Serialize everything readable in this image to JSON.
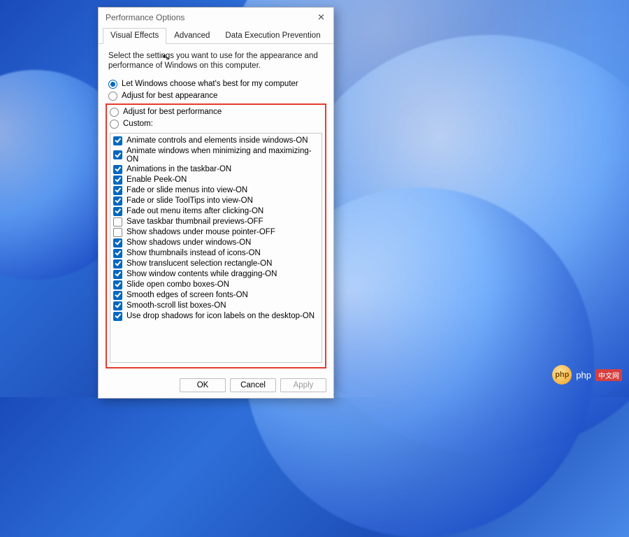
{
  "dialog": {
    "title": "Performance Options",
    "tabs": [
      {
        "label": "Visual Effects",
        "active": true
      },
      {
        "label": "Advanced",
        "active": false
      },
      {
        "label": "Data Execution Prevention",
        "active": false
      }
    ],
    "description": "Select the settings you want to use for the appearance and performance of Windows on this computer.",
    "radios": [
      {
        "label": "Let Windows choose what's best for my computer",
        "selected": true,
        "in_highlight": false
      },
      {
        "label": "Adjust for best appearance",
        "selected": false,
        "in_highlight": false
      },
      {
        "label": "Adjust for best performance",
        "selected": false,
        "in_highlight": true
      },
      {
        "label": "Custom:",
        "selected": false,
        "in_highlight": true
      }
    ],
    "checkboxes": [
      {
        "label": "Animate controls and elements inside windows-ON",
        "checked": true
      },
      {
        "label": "Animate windows when minimizing and maximizing-ON",
        "checked": true
      },
      {
        "label": "Animations in the taskbar-ON",
        "checked": true
      },
      {
        "label": "Enable Peek-ON",
        "checked": true
      },
      {
        "label": "Fade or slide menus into view-ON",
        "checked": true
      },
      {
        "label": "Fade or slide ToolTips into view-ON",
        "checked": true
      },
      {
        "label": "Fade out menu items after clicking-ON",
        "checked": true
      },
      {
        "label": "Save taskbar thumbnail previews-OFF",
        "checked": false
      },
      {
        "label": "Show shadows under mouse pointer-OFF",
        "checked": false
      },
      {
        "label": "Show shadows under windows-ON",
        "checked": true
      },
      {
        "label": "Show thumbnails instead of icons-ON",
        "checked": true
      },
      {
        "label": "Show translucent selection rectangle-ON",
        "checked": true
      },
      {
        "label": "Show window contents while dragging-ON",
        "checked": true
      },
      {
        "label": "Slide open combo boxes-ON",
        "checked": true
      },
      {
        "label": "Smooth edges of screen fonts-ON",
        "checked": true
      },
      {
        "label": "Smooth-scroll list boxes-ON",
        "checked": true
      },
      {
        "label": "Use drop shadows for icon labels on the desktop-ON",
        "checked": true
      }
    ],
    "buttons": {
      "ok": "OK",
      "cancel": "Cancel",
      "apply": "Apply"
    }
  },
  "watermark": {
    "logo_text": "php",
    "text": "php",
    "cn": "中文网"
  }
}
